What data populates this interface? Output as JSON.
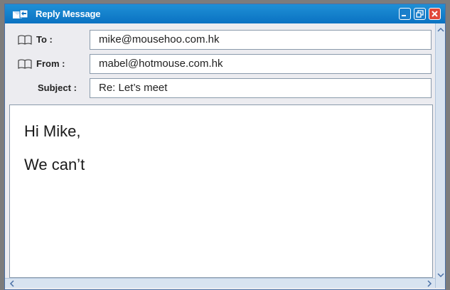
{
  "window": {
    "title": "Reply Message",
    "title_icon": "mail-reply-icon",
    "buttons": [
      "minimize-icon",
      "maximize-icon",
      "close-icon"
    ]
  },
  "header": {
    "to_label": "To :",
    "to_value": "mike@mousehoo.com.hk",
    "from_label": "From :",
    "from_value": "mabel@hotmouse.com.hk",
    "subject_label": "Subject :",
    "subject_value": "Re: Let’s meet"
  },
  "message": {
    "lines": [
      "Hi Mike,",
      "We can’t"
    ]
  },
  "colors": {
    "titlebar": "#0a72c2",
    "close_button": "#e0483a",
    "window_background": "#ececf0"
  }
}
